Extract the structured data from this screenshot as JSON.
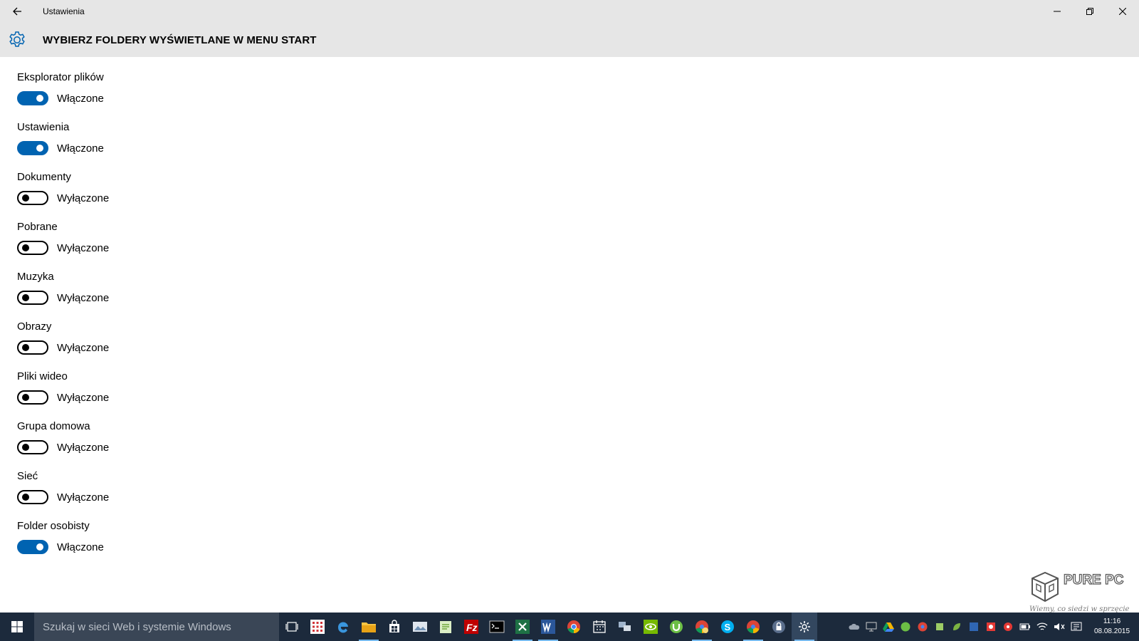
{
  "window": {
    "app_title": "Ustawienia",
    "page_title": "WYBIERZ FOLDERY WYŚWIETLANE W MENU START"
  },
  "settings": [
    {
      "label": "Eksplorator plików",
      "state": "Włączone",
      "on": true
    },
    {
      "label": "Ustawienia",
      "state": "Włączone",
      "on": true
    },
    {
      "label": "Dokumenty",
      "state": "Wyłączone",
      "on": false
    },
    {
      "label": "Pobrane",
      "state": "Wyłączone",
      "on": false
    },
    {
      "label": "Muzyka",
      "state": "Wyłączone",
      "on": false
    },
    {
      "label": "Obrazy",
      "state": "Wyłączone",
      "on": false
    },
    {
      "label": "Pliki wideo",
      "state": "Wyłączone",
      "on": false
    },
    {
      "label": "Grupa domowa",
      "state": "Wyłączone",
      "on": false
    },
    {
      "label": "Sieć",
      "state": "Wyłączone",
      "on": false
    },
    {
      "label": "Folder osobisty",
      "state": "Włączone",
      "on": true
    }
  ],
  "taskbar": {
    "search_placeholder": "Szukaj w sieci Web i systemie Windows",
    "pinned": [
      "task-view-icon",
      "store-tiles-icon",
      "edge-icon",
      "file-explorer-icon",
      "store-icon",
      "photo-icon",
      "notepad-icon",
      "filezilla-icon",
      "cmd-icon",
      "excel-icon",
      "word-icon",
      "chrome-icon",
      "calendar-icon",
      "network-icon",
      "nvidia-icon",
      "utorrent-icon",
      "chrome-profile-icon",
      "skype-icon",
      "chrome-alt-icon",
      "vpn-icon",
      "settings-icon"
    ],
    "clock_time": "11:16",
    "clock_date": "08.08.2015"
  },
  "watermark": {
    "brand": "PURE PC",
    "tagline": "Wiemy, co siedzi w sprzęcie"
  },
  "colors": {
    "accent": "#0063b1",
    "header_bg": "#e6e6e6",
    "taskbar_bg": "#1c2a3c"
  }
}
